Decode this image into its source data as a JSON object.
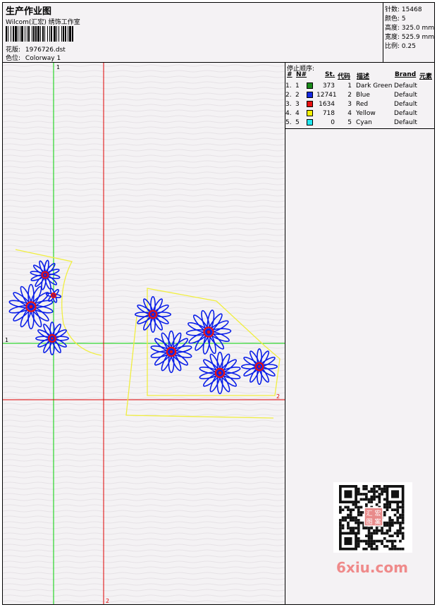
{
  "header": {
    "title": "生产作业图",
    "subtitle": "Wilcom(汇宏) 绣饰工作室",
    "design_label": "花版:",
    "design_file": "1976726.dst",
    "colorway_label": "色位:",
    "colorway_value": "Colorway 1"
  },
  "specs": [
    {
      "label": "针数:",
      "value": "15468"
    },
    {
      "label": "颜色:",
      "value": "5"
    },
    {
      "label": "高度:",
      "value": "325.0 mm"
    },
    {
      "label": "宽度:",
      "value": "525.9 mm"
    },
    {
      "label": "比例:",
      "value": "0.25"
    }
  ],
  "stop_sequence": {
    "title": "停止顺序:",
    "columns": [
      "#",
      "N#",
      "St.",
      "代码",
      "描述",
      "Brand",
      "元素"
    ],
    "rows": [
      {
        "idx": "1.",
        "n": "1",
        "color": "#1a8a1a",
        "st": "373",
        "code": "1",
        "desc": "Dark Green",
        "brand": "Default"
      },
      {
        "idx": "2.",
        "n": "2",
        "color": "#1428e0",
        "st": "12741",
        "code": "2",
        "desc": "Blue",
        "brand": "Default"
      },
      {
        "idx": "3.",
        "n": "3",
        "color": "#e81010",
        "st": "1634",
        "code": "3",
        "desc": "Red",
        "brand": "Default"
      },
      {
        "idx": "4.",
        "n": "4",
        "color": "#f4f000",
        "st": "718",
        "code": "4",
        "desc": "Yellow",
        "brand": "Default"
      },
      {
        "idx": "5.",
        "n": "5",
        "color": "#20e8f0",
        "st": "0",
        "code": "5",
        "desc": "Cyan",
        "brand": "Default"
      }
    ]
  },
  "design": {
    "axis_labels": [
      "1",
      "1",
      "2",
      "2"
    ],
    "colors": {
      "green_axis": "#00d000",
      "red_axis": "#e00000",
      "blue_thread": "#0a1ee8",
      "red_thread": "#e81010",
      "yellow_outline": "#f0ee40"
    }
  },
  "watermark": {
    "qr_seal": "汇宏图案",
    "site": "6xiu.com"
  }
}
